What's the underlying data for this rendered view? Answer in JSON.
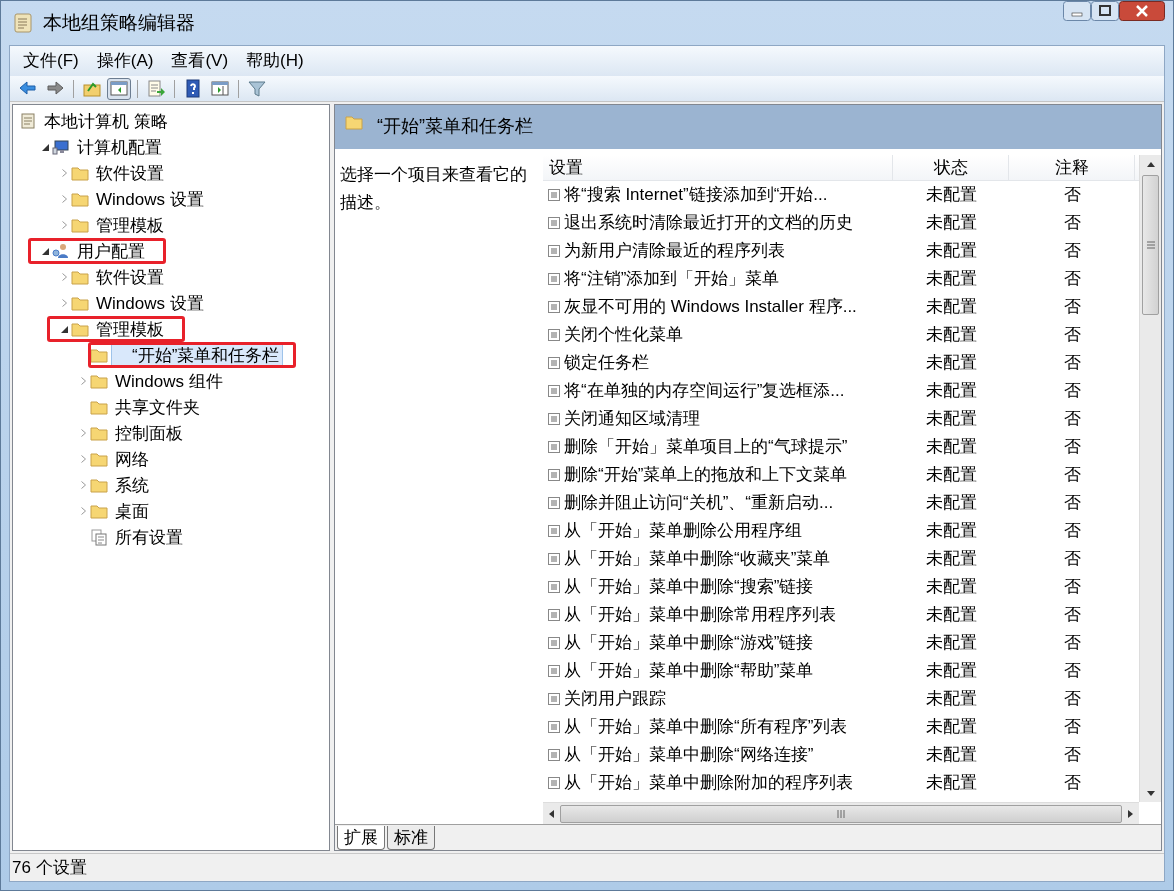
{
  "window": {
    "title": "本地组策略编辑器"
  },
  "menu": [
    "文件(F)",
    "操作(A)",
    "查看(V)",
    "帮助(H)"
  ],
  "toolbar": [
    {
      "kind": "back",
      "pressed": false
    },
    {
      "kind": "forward",
      "pressed": false
    },
    {
      "kind": "separator"
    },
    {
      "kind": "up",
      "pressed": false
    },
    {
      "kind": "tree",
      "pressed": true
    },
    {
      "kind": "separator"
    },
    {
      "kind": "export",
      "pressed": false
    },
    {
      "kind": "separator"
    },
    {
      "kind": "help",
      "pressed": false
    },
    {
      "kind": "pane",
      "pressed": false
    },
    {
      "kind": "separator"
    },
    {
      "kind": "filter",
      "pressed": false
    }
  ],
  "tree": [
    {
      "label": "本地计算机 策略",
      "kind": "policy",
      "selected": false,
      "highlighted": false,
      "children": [
        {
          "label": "计算机配置",
          "kind": "computer",
          "expanded": true,
          "selected": false,
          "highlighted": false,
          "children": [
            {
              "label": "软件设置",
              "kind": "folder",
              "expanded": false,
              "selected": false,
              "highlighted": false
            },
            {
              "label": "Windows 设置",
              "kind": "folder",
              "expanded": false,
              "selected": false,
              "highlighted": false
            },
            {
              "label": "管理模板",
              "kind": "folder",
              "expanded": false,
              "selected": false,
              "highlighted": false
            }
          ]
        },
        {
          "label": "用户配置",
          "kind": "user",
          "expanded": true,
          "selected": false,
          "highlighted": true,
          "children": [
            {
              "label": "软件设置",
              "kind": "folder",
              "expanded": false,
              "selected": false,
              "highlighted": false
            },
            {
              "label": "Windows 设置",
              "kind": "folder",
              "expanded": false,
              "selected": false,
              "highlighted": false
            },
            {
              "label": "管理模板",
              "kind": "folder",
              "expanded": true,
              "selected": false,
              "highlighted": true,
              "children": [
                {
                  "label": "“开始”菜单和任务栏",
                  "kind": "folder",
                  "selected": true,
                  "highlighted": true
                },
                {
                  "label": "Windows 组件",
                  "kind": "folder",
                  "expanded": false,
                  "selected": false,
                  "highlighted": false
                },
                {
                  "label": "共享文件夹",
                  "kind": "folder",
                  "selected": false,
                  "highlighted": false
                },
                {
                  "label": "控制面板",
                  "kind": "folder",
                  "expanded": false,
                  "selected": false,
                  "highlighted": false
                },
                {
                  "label": "网络",
                  "kind": "folder",
                  "expanded": false,
                  "selected": false,
                  "highlighted": false
                },
                {
                  "label": "系统",
                  "kind": "folder",
                  "expanded": false,
                  "selected": false,
                  "highlighted": false
                },
                {
                  "label": "桌面",
                  "kind": "folder",
                  "expanded": false,
                  "selected": false,
                  "highlighted": false
                },
                {
                  "label": "所有设置",
                  "kind": "allsettings",
                  "selected": false,
                  "highlighted": false
                }
              ]
            }
          ]
        }
      ]
    }
  ],
  "details": {
    "heading": "“开始”菜单和任务栏",
    "description": "选择一个项目来查看它的描述。",
    "columns": [
      "设置",
      "状态",
      "注释"
    ],
    "rows": [
      [
        "将“搜索 Internet”链接添加到“开始...",
        "未配置",
        "否"
      ],
      [
        "退出系统时清除最近打开的文档的历史",
        "未配置",
        "否"
      ],
      [
        "为新用户清除最近的程序列表",
        "未配置",
        "否"
      ],
      [
        "将“注销”添加到「开始」菜单",
        "未配置",
        "否"
      ],
      [
        "灰显不可用的 Windows Installer 程序...",
        "未配置",
        "否"
      ],
      [
        "关闭个性化菜单",
        "未配置",
        "否"
      ],
      [
        "锁定任务栏",
        "未配置",
        "否"
      ],
      [
        "将“在单独的内存空间运行”复选框添...",
        "未配置",
        "否"
      ],
      [
        "关闭通知区域清理",
        "未配置",
        "否"
      ],
      [
        "删除「开始」菜单项目上的“气球提示”",
        "未配置",
        "否"
      ],
      [
        "删除“开始”菜单上的拖放和上下文菜单",
        "未配置",
        "否"
      ],
      [
        "删除并阻止访问“关机”、“重新启动...",
        "未配置",
        "否"
      ],
      [
        "从「开始」菜单删除公用程序组",
        "未配置",
        "否"
      ],
      [
        "从「开始」菜单中删除“收藏夹”菜单",
        "未配置",
        "否"
      ],
      [
        "从「开始」菜单中删除“搜索”链接",
        "未配置",
        "否"
      ],
      [
        "从「开始」菜单中删除常用程序列表",
        "未配置",
        "否"
      ],
      [
        "从「开始」菜单中删除“游戏”链接",
        "未配置",
        "否"
      ],
      [
        "从「开始」菜单中删除“帮助”菜单",
        "未配置",
        "否"
      ],
      [
        "关闭用户跟踪",
        "未配置",
        "否"
      ],
      [
        "从「开始」菜单中删除“所有程序”列表",
        "未配置",
        "否"
      ],
      [
        "从「开始」菜单中删除“网络连接”",
        "未配置",
        "否"
      ],
      [
        "从「开始」菜单中删除附加的程序列表",
        "未配置",
        "否"
      ]
    ]
  },
  "tabs": [
    {
      "label": "扩展",
      "selected": true
    },
    {
      "label": "标准",
      "selected": false
    }
  ],
  "status_bar": "76 个设置"
}
